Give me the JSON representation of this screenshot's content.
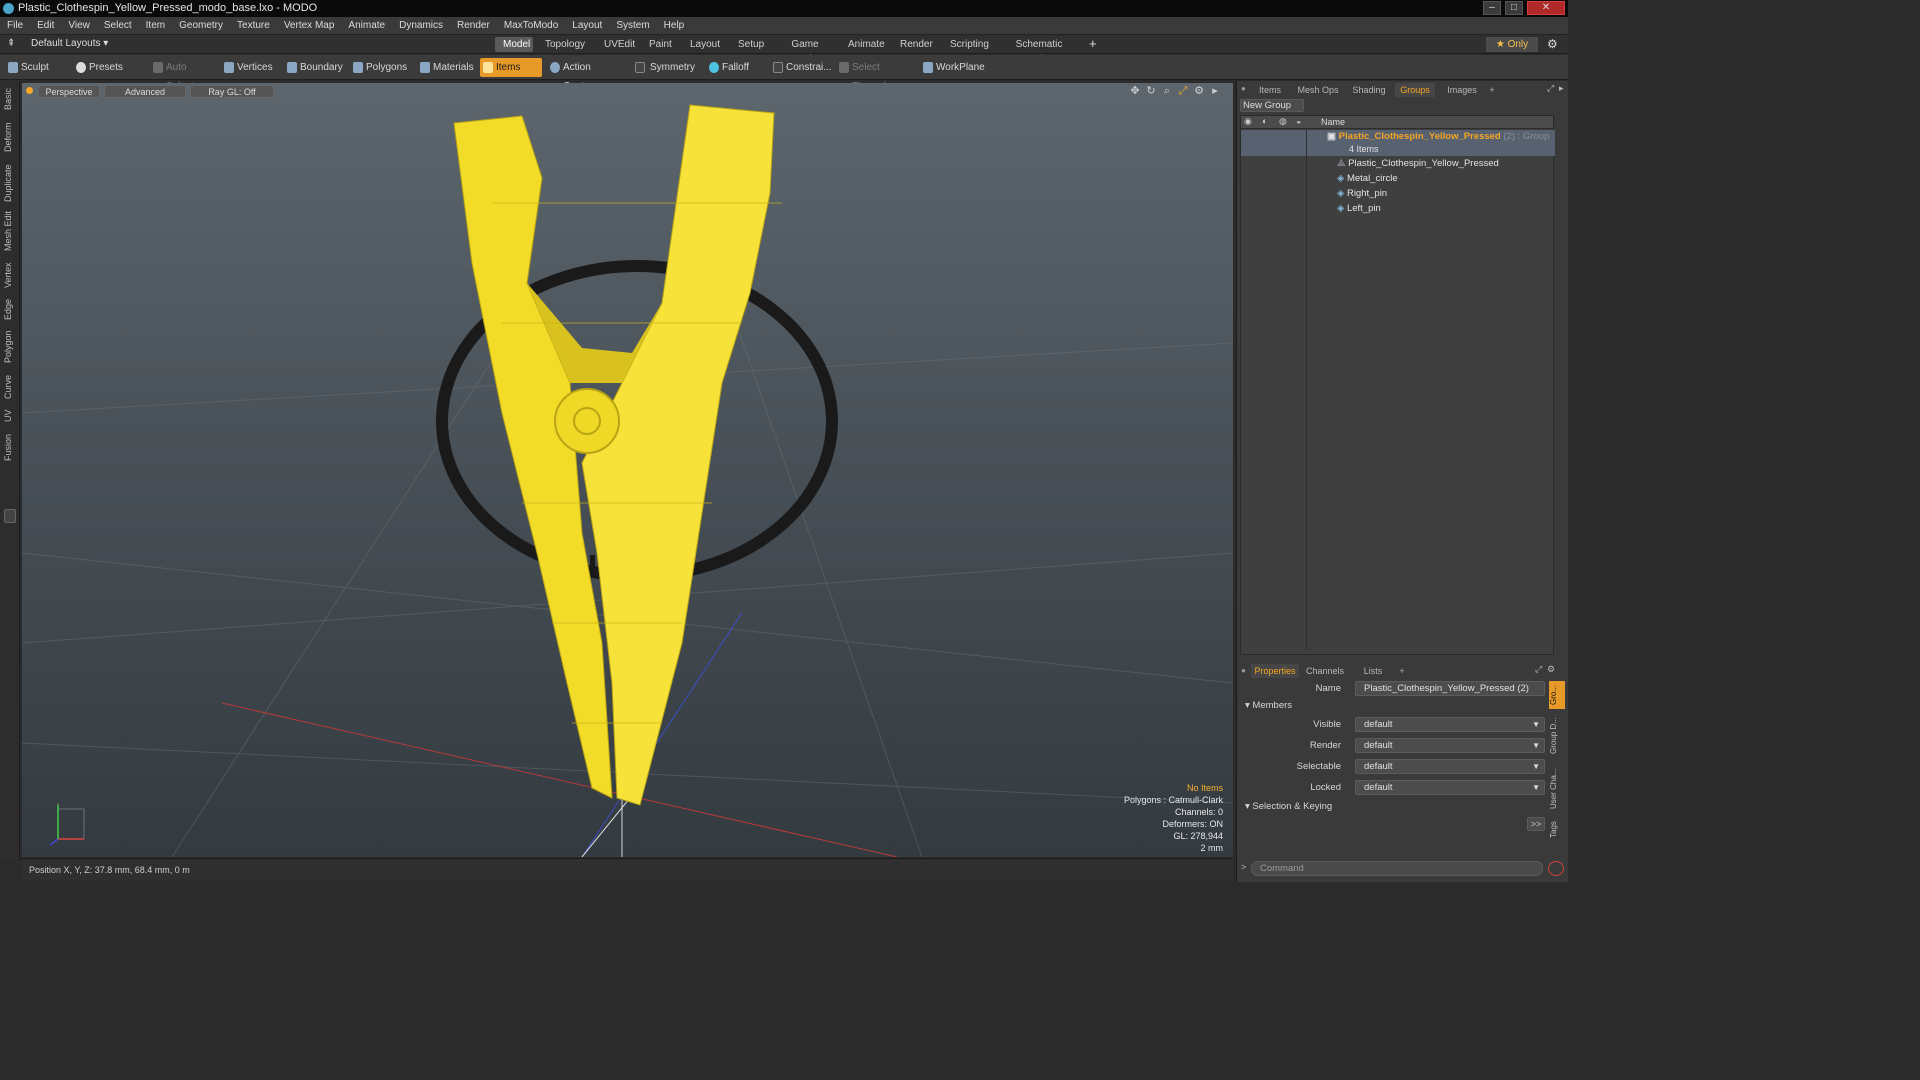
{
  "window": {
    "title": "Plastic_Clothespin_Yellow_Pressed_modo_base.lxo - MODO"
  },
  "menu": [
    "File",
    "Edit",
    "View",
    "Select",
    "Item",
    "Geometry",
    "Texture",
    "Vertex Map",
    "Animate",
    "Dynamics",
    "Render",
    "MaxToModo",
    "Layout",
    "System",
    "Help"
  ],
  "layouts": {
    "preset": "Default Layouts ▾",
    "tabs": [
      "Model",
      "Topology",
      "UVEdit",
      "Paint",
      "Layout",
      "Setup",
      "Game Tools",
      "Animate",
      "Render",
      "Scripting",
      "Schematic Fusion"
    ],
    "add": "+",
    "only": "★ Only"
  },
  "toolbar": {
    "sculpt": "Sculpt",
    "presets": "Presets",
    "auto_select": "Auto Select",
    "vertices": "Vertices",
    "boundary": "Boundary",
    "polygons": "Polygons",
    "materials": "Materials",
    "items": "Items",
    "action_center": "Action Center",
    "symmetry": "Symmetry",
    "falloff": "Falloff",
    "constraints": "Constrai...",
    "select_through": "Select Through",
    "workplane": "WorkPlane"
  },
  "left_tabs": [
    "Basic",
    "Deform",
    "Duplicate",
    "Mesh Edit",
    "Vertex",
    "Edge",
    "Polygon",
    "Curve",
    "UV",
    "Fusion"
  ],
  "viewport": {
    "view": "Perspective",
    "advanced": "Advanced",
    "raygl": "Ray GL: Off",
    "info": {
      "selection": "No Items",
      "polygons": "Polygons : Catmull-Clark",
      "channels": "Channels: 0",
      "deformers": "Deformers: ON",
      "gl": "GL: 278,944",
      "scale": "2 mm"
    }
  },
  "status": {
    "position": "Position X, Y, Z:  37.8 mm, 68.4 mm, 0 m"
  },
  "right_panel": {
    "tabs": [
      "Items",
      "Mesh Ops",
      "Shading",
      "Groups",
      "Images"
    ],
    "tab_add": "+",
    "new_group": "New Group",
    "col_name": "Name",
    "group": {
      "name": "Plastic_Clothespin_Yellow_Pressed",
      "suffix": "(2) : Group",
      "count": "4 Items"
    },
    "children": [
      "Plastic_Clothespin_Yellow_Pressed",
      "Metal_circle",
      "Right_pin",
      "Left_pin"
    ],
    "prop_tabs": [
      "Properties",
      "Channels",
      "Lists"
    ],
    "prop_add": "+",
    "props": {
      "name_label": "Name",
      "name_value": "Plastic_Clothespin_Yellow_Pressed (2)",
      "members": "Members",
      "visible_label": "Visible",
      "visible_value": "default",
      "render_label": "Render",
      "render_value": "default",
      "selectable_label": "Selectable",
      "selectable_value": "default",
      "locked_label": "Locked",
      "locked_value": "default",
      "selection_keying": "Selection & Keying",
      "more": ">>"
    },
    "side_tabs": [
      "Gro...",
      "Group D...",
      "User Cha...",
      "Tags"
    ],
    "command_placeholder": "Command"
  },
  "colors": {
    "accent": "#f5a623",
    "clothespin": "#f2dc28",
    "ring": "#1c1c1c"
  }
}
